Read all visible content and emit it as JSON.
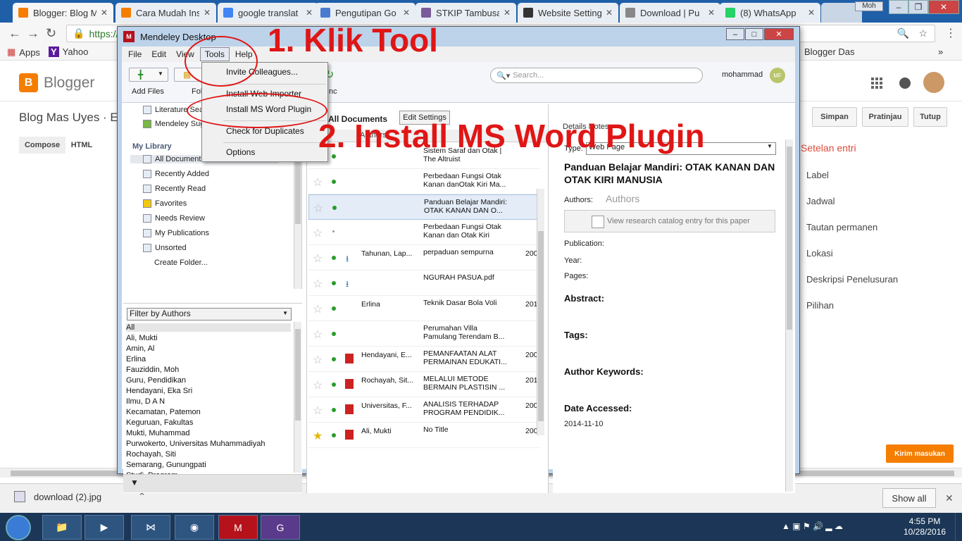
{
  "browser": {
    "tabs": [
      {
        "label": "Blogger: Blog M",
        "icon": "blogger-icon",
        "color": "#f57d00"
      },
      {
        "label": "Cara Mudah Ins",
        "icon": "blogger-icon",
        "color": "#f57d00"
      },
      {
        "label": "google translat",
        "icon": "google-icon",
        "color": "#4285f4"
      },
      {
        "label": "Pengutipan Go",
        "icon": "scholar-icon",
        "color": "#4a7bd0"
      },
      {
        "label": "STKIP Tambusa",
        "icon": "stkip-icon",
        "color": "#7a5a9a"
      },
      {
        "label": "Website Setting",
        "icon": "pkp-icon",
        "color": "#333333"
      },
      {
        "label": "Download | Pu",
        "icon": "page-icon",
        "color": "#888888"
      },
      {
        "label": "(8) WhatsApp",
        "icon": "whatsapp-icon",
        "color": "#25d366"
      }
    ],
    "profile": "Moh",
    "url": "https://",
    "bookmarks": {
      "apps": "Apps",
      "yahoo": "Yahoo",
      "blogger_dash": "Blogger Das"
    }
  },
  "blogger": {
    "brand": "Blogger",
    "blog_title": "Blog Mas Uyes · En",
    "buttons": {
      "save": "Simpan",
      "preview": "Pratinjau",
      "close": "Tutup"
    },
    "modes": {
      "compose": "Compose",
      "html": "HTML"
    },
    "settings_title": "Setelan entri",
    "settings": [
      "Label",
      "Jadwal",
      "Tautan permanen",
      "Lokasi",
      "Deskripsi Penelusuran",
      "Pilihan"
    ],
    "feedback": "Kirim masukan"
  },
  "downloads": {
    "file": "download (2).jpg",
    "show_all": "Show all"
  },
  "taskbar": {
    "time": "4:55 PM",
    "date": "10/28/2016"
  },
  "mendeley": {
    "title": "Mendeley Desktop",
    "menu": [
      "File",
      "Edit",
      "View",
      "Tools",
      "Help"
    ],
    "toolbar": {
      "add_files": "Add Files",
      "folder": "Fol",
      "sync": "nc",
      "search_placeholder": "Search...",
      "user": "mohammad",
      "user_initials": "MF"
    },
    "tools_menu": [
      "Invite Colleagues...",
      "Install Web Importer",
      "Install MS Word Plugin",
      "Check for Duplicates",
      "Options"
    ],
    "library": {
      "top_items": [
        "Literature Sea",
        "Mendeley Sug"
      ],
      "heading": "My Library",
      "items": [
        "All Documents",
        "Recently Added",
        "Recently Read",
        "Favorites",
        "Needs Review",
        "My Publications",
        "Unsorted",
        "Create Folder..."
      ]
    },
    "filter": {
      "label": "Filter by Authors",
      "authors": [
        "All",
        "Ali, Mukti",
        "Amin, Al",
        "Erlina",
        "Fauziddin, Moh",
        "Guru, Pendidikan",
        "Hendayani, Eka Sri",
        "Ilmu, D A N",
        "Kecamatan, Patemon",
        "Keguruan, Fakultas",
        "Mukti, Muhammad",
        "Purwokerto, Universitas Muhammadiyah",
        "Rochayah, Siti",
        "Semarang, Gunungpati",
        "Studi, Program"
      ]
    },
    "docs": {
      "heading": "All Documents",
      "edit_settings": "Edit Settings",
      "col_authors": "Authors",
      "rows": [
        {
          "author": "",
          "title": "Sistem Saraf dan Otak | The Altruist",
          "year": "",
          "fav": false,
          "file": "",
          "read": true,
          "selected": false
        },
        {
          "author": "",
          "title": "Perbedaan Fungsi Otak Kanan danOtak Kiri Ma...",
          "year": "",
          "fav": false,
          "file": "",
          "read": true,
          "selected": false
        },
        {
          "author": "",
          "title": "Panduan Belajar Mandiri: OTAK KANAN DAN O...",
          "year": "",
          "fav": false,
          "file": "",
          "read": true,
          "selected": true
        },
        {
          "author": "",
          "title": "Perbedaan Fungsi Otak Kanan dan Otak Kiri",
          "year": "",
          "fav": false,
          "file": "",
          "read": false,
          "selected": false
        },
        {
          "author": "Tahunan, Lap...",
          "title": "perpaduan sempurna",
          "year": "200",
          "fav": false,
          "file": "download",
          "read": true,
          "selected": false
        },
        {
          "author": "",
          "title": "NGURAH PASUA.pdf",
          "year": "",
          "fav": false,
          "file": "download",
          "read": true,
          "selected": false
        },
        {
          "author": "Erlina",
          "title": "Teknik Dasar Bola Voli",
          "year": "201",
          "fav": false,
          "file": "",
          "read": true,
          "selected": false
        },
        {
          "author": "",
          "title": "Perumahan Villa Pamulang Terendam B...",
          "year": "",
          "fav": false,
          "file": "",
          "read": true,
          "selected": false
        },
        {
          "author": "Hendayani, E...",
          "title": "PEMANFAATAN ALAT PERMAINAN EDUKATI...",
          "year": "200",
          "fav": false,
          "file": "pdf",
          "read": true,
          "selected": false
        },
        {
          "author": "Rochayah, Sit...",
          "title": "MELALUI METODE BERMAIN PLASTISIN ...",
          "year": "201",
          "fav": false,
          "file": "pdf",
          "read": true,
          "selected": false
        },
        {
          "author": "Universitas, F...",
          "title": "ANALISIS TERHADAP PROGRAM PENDIDIK...",
          "year": "200",
          "fav": false,
          "file": "pdf",
          "read": true,
          "selected": false
        },
        {
          "author": "Ali, Mukti",
          "title": "No Title",
          "year": "200",
          "fav": true,
          "file": "pdf",
          "read": true,
          "selected": false
        }
      ]
    },
    "details": {
      "tabs": "Details   Notes",
      "type_label": "Type:",
      "type_value": "Web Page",
      "title": "Panduan Belajar Mandiri: OTAK KANAN DAN OTAK KIRI MANUSIA",
      "authors_label": "Authors:",
      "authors_value": "Authors",
      "catalog": "View research catalog entry for this paper",
      "publication_label": "Publication:",
      "year_label": "Year:",
      "pages_label": "Pages:",
      "abstract": "Abstract:",
      "tags": "Tags:",
      "keywords": "Author Keywords:",
      "accessed": "Date Accessed:",
      "accessed_value": "2014-11-10"
    }
  },
  "annotations": {
    "step1": "1. Klik Tool",
    "step2": "2. Install MS Word Plugin"
  }
}
